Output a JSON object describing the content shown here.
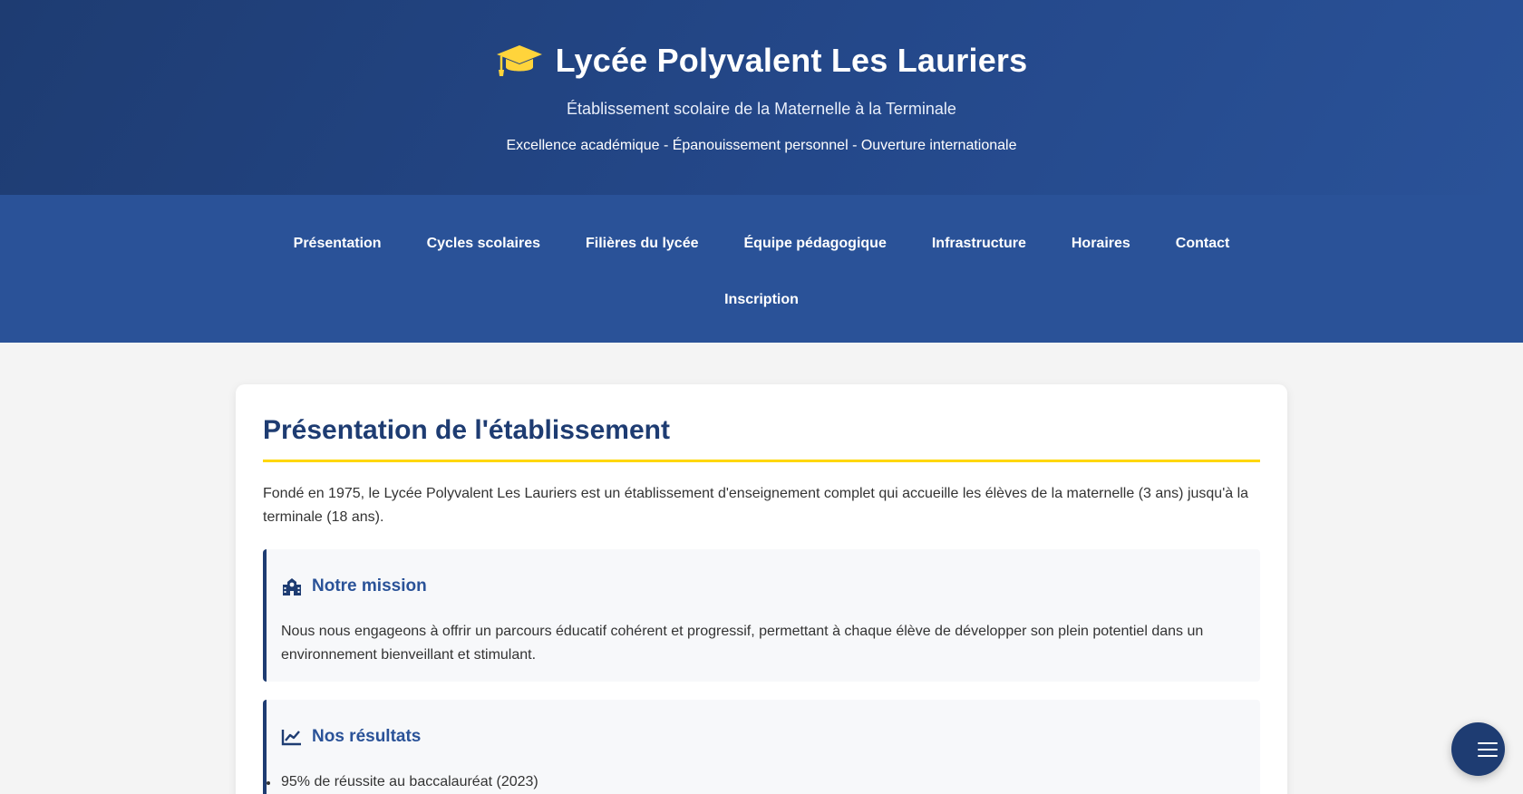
{
  "header": {
    "title": "Lycée Polyvalent Les Lauriers",
    "logo_icon": "graduation-cap-icon",
    "subtitle": "Établissement scolaire de la Maternelle à la Terminale",
    "tagline": "Excellence académique - Épanouissement personnel - Ouverture internationale"
  },
  "nav": {
    "items": [
      {
        "label": "Présentation"
      },
      {
        "label": "Cycles scolaires"
      },
      {
        "label": "Filières du lycée"
      },
      {
        "label": "Équipe pédagogique"
      },
      {
        "label": "Infrastructure"
      },
      {
        "label": "Horaires"
      },
      {
        "label": "Contact"
      },
      {
        "label": "Inscription"
      }
    ]
  },
  "presentation": {
    "heading": "Présentation de l'établissement",
    "intro": "Fondé en 1975, le Lycée Polyvalent Les Lauriers est un établissement d'enseignement complet qui accueille les élèves de la maternelle (3 ans) jusqu'à la terminale (18 ans).",
    "mission": {
      "icon": "school-icon",
      "title": "Notre mission",
      "text": "Nous nous engageons à offrir un parcours éducatif cohérent et progressif, permettant à chaque élève de développer son plein potentiel dans un environnement bienveillant et stimulant."
    },
    "results": {
      "icon": "chart-line-icon",
      "title": "Nos résultats",
      "items": [
        "95% de réussite au baccalauréat (2023)"
      ]
    }
  },
  "fab": {
    "icon": "menu-icon"
  },
  "colors": {
    "primary": "#1e3c72",
    "secondary": "#2a5298",
    "accent": "#ffd700",
    "background": "#f4f4f4"
  }
}
